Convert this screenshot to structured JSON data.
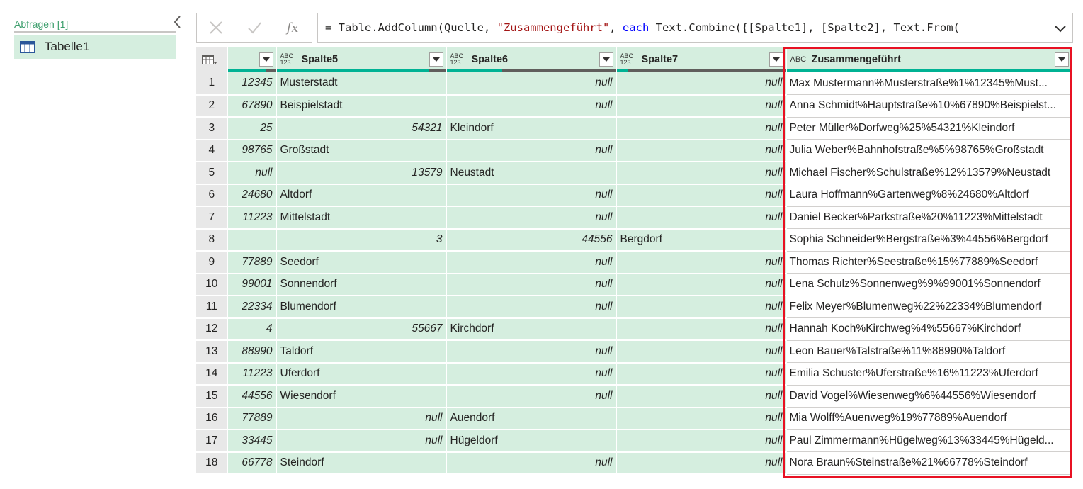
{
  "queries": {
    "title": "Abfragen [1]",
    "items": [
      {
        "label": "Tabelle1"
      }
    ]
  },
  "formula": {
    "prefix": "= Table.AddColumn(Quelle, ",
    "string": "\"Zusammengeführt\"",
    "middle": ", ",
    "keyword": "each",
    "suffix": " Text.Combine({[Spalte1], [Spalte2], Text.From(",
    "fx_label": "fx"
  },
  "columns": [
    {
      "name": "Spalte5",
      "type_top": "ABC",
      "type_bottom": "123"
    },
    {
      "name": "Spalte6",
      "type_top": "ABC",
      "type_bottom": "123"
    },
    {
      "name": "Spalte7",
      "type_top": "ABC",
      "type_bottom": "123"
    },
    {
      "name": "Zusammengeführt",
      "type_top": "ABC",
      "type_bottom": ""
    }
  ],
  "rows": [
    {
      "n": "1",
      "a": "12345",
      "b": "Musterstadt",
      "c": "null",
      "d": "null",
      "e": "Max Mustermann%Musterstraße%1%12345%Must..."
    },
    {
      "n": "2",
      "a": "67890",
      "b": "Beispielstadt",
      "c": "null",
      "d": "null",
      "e": "Anna Schmidt%Hauptstraße%10%67890%Beispielst..."
    },
    {
      "n": "3",
      "a": "25",
      "b": "54321",
      "c": "Kleindorf",
      "d": "null",
      "e": "Peter Müller%Dorfweg%25%54321%Kleindorf"
    },
    {
      "n": "4",
      "a": "98765",
      "b": "Großstadt",
      "c": "null",
      "d": "null",
      "e": "Julia Weber%Bahnhofstraße%5%98765%Großstadt"
    },
    {
      "n": "5",
      "a": "null",
      "b": "13579",
      "c": "Neustadt",
      "d": "null",
      "e": "Michael Fischer%Schulstraße%12%13579%Neustadt"
    },
    {
      "n": "6",
      "a": "24680",
      "b": "Altdorf",
      "c": "null",
      "d": "null",
      "e": "Laura Hoffmann%Gartenweg%8%24680%Altdorf"
    },
    {
      "n": "7",
      "a": "11223",
      "b": "Mittelstadt",
      "c": "null",
      "d": "null",
      "e": "Daniel Becker%Parkstraße%20%11223%Mittelstadt"
    },
    {
      "n": "8",
      "a": "",
      "b": "3",
      "c": "44556",
      "d": "Bergdorf",
      "e": "Sophia Schneider%Bergstraße%3%44556%Bergdorf"
    },
    {
      "n": "9",
      "a": "77889",
      "b": "Seedorf",
      "c": "null",
      "d": "null",
      "e": "Thomas Richter%Seestraße%15%77889%Seedorf"
    },
    {
      "n": "10",
      "a": "99001",
      "b": "Sonnendorf",
      "c": "null",
      "d": "null",
      "e": "Lena Schulz%Sonnenweg%9%99001%Sonnendorf"
    },
    {
      "n": "11",
      "a": "22334",
      "b": "Blumendorf",
      "c": "null",
      "d": "null",
      "e": "Felix Meyer%Blumenweg%22%22334%Blumendorf"
    },
    {
      "n": "12",
      "a": "4",
      "b": "55667",
      "c": "Kirchdorf",
      "d": "null",
      "e": "Hannah Koch%Kirchweg%4%55667%Kirchdorf"
    },
    {
      "n": "13",
      "a": "88990",
      "b": "Taldorf",
      "c": "null",
      "d": "null",
      "e": "Leon Bauer%Talstraße%11%88990%Taldorf"
    },
    {
      "n": "14",
      "a": "11223",
      "b": "Uferdorf",
      "c": "null",
      "d": "null",
      "e": "Emilia Schuster%Uferstraße%16%11223%Uferdorf"
    },
    {
      "n": "15",
      "a": "44556",
      "b": "Wiesendorf",
      "c": "null",
      "d": "null",
      "e": "David Vogel%Wiesenweg%6%44556%Wiesendorf"
    },
    {
      "n": "16",
      "a": "77889",
      "b": "null",
      "c": "Auendorf",
      "d": "null",
      "e": "Mia Wolff%Auenweg%19%77889%Auendorf"
    },
    {
      "n": "17",
      "a": "33445",
      "b": "null",
      "c": "Hügeldorf",
      "d": "null",
      "e": "Paul Zimmermann%Hügelweg%13%33445%Hügeld..."
    },
    {
      "n": "18",
      "a": "66778",
      "b": "Steindorf",
      "c": "null",
      "d": "null",
      "e": "Nora Braun%Steinstraße%21%66778%Steindorf"
    }
  ],
  "colors": {
    "accent_green": "#3c9e6c",
    "cell_green": "#d5eedf",
    "highlight_red": "#e81123",
    "quality_valid": "#00b294"
  }
}
